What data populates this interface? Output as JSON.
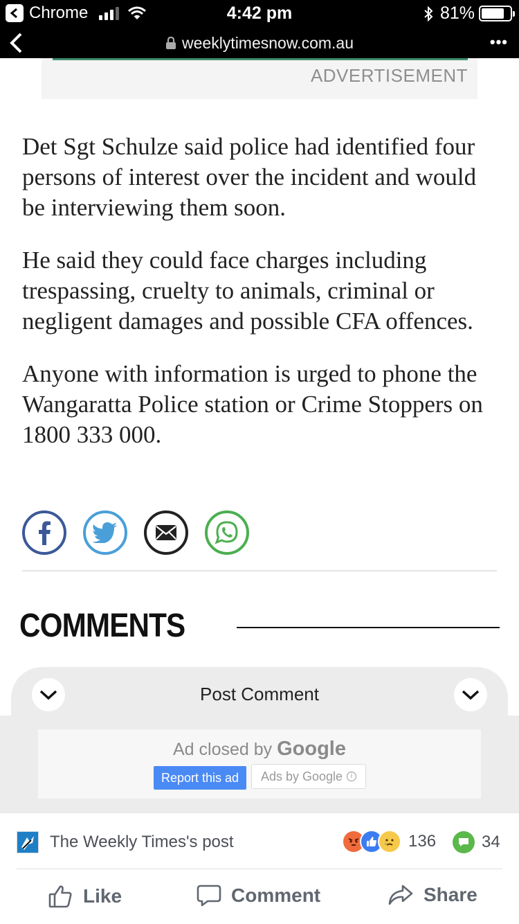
{
  "status_bar": {
    "app": "Chrome",
    "time": "4:42 pm",
    "battery": "81%",
    "battery_level": 0.81
  },
  "url_bar": {
    "url": "weeklytimesnow.com.au",
    "more": "•••"
  },
  "ad_top": {
    "label": "ADVERTISEMENT"
  },
  "article": {
    "paragraphs": [
      "Det Sgt Schulze said police had identified four persons of interest over the incident and would be interviewing them soon.",
      "He said they could face charges including trespassing, cruelty to animals, criminal or negligent damages and possible CFA offences.",
      "Anyone with information is urged to phone the Wangaratta Police station or Crime Stoppers on 1800 333 000."
    ]
  },
  "share": {
    "icons": [
      "facebook-icon",
      "twitter-icon",
      "email-icon",
      "whatsapp-icon"
    ],
    "colors": {
      "facebook": "#3b5998",
      "twitter": "#4a9fd8",
      "email": "#222222",
      "whatsapp": "#4caf50"
    }
  },
  "comments": {
    "title": "COMMENTS",
    "post_comment_label": "Post Comment"
  },
  "google_ad": {
    "closed_text": "Ad closed by",
    "google_word": "Google",
    "report_label": "Report this ad",
    "ads_by_label": "Ads by Google"
  },
  "facebook_bar": {
    "post_name": "The Weekly Times's post",
    "reaction_count": "136",
    "comment_count": "34",
    "like_label": "Like",
    "comment_label": "Comment",
    "share_label": "Share"
  }
}
